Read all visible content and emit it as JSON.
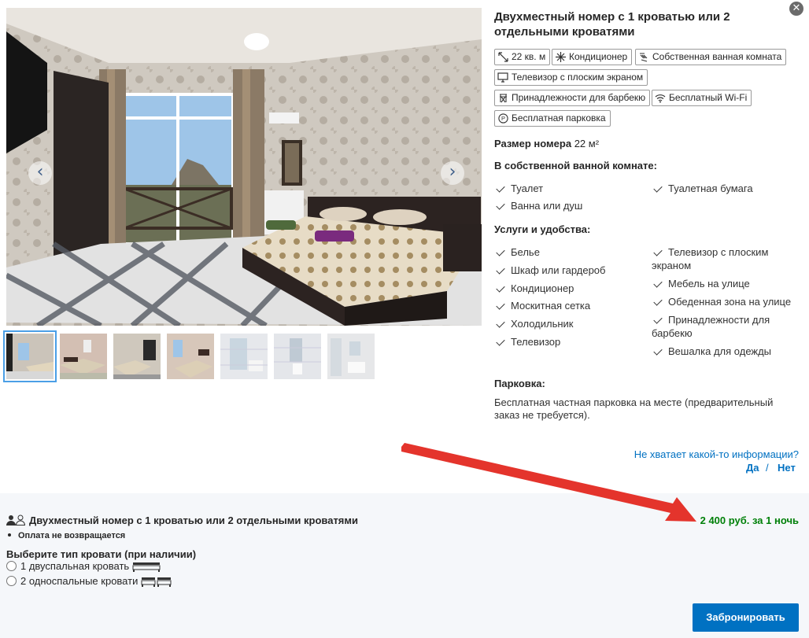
{
  "room": {
    "title": "Двухместный номер с 1 кроватью или 2 отдельными кроватями"
  },
  "facilities_chips": [
    {
      "label": "22 кв. м",
      "icon": "room-size-icon"
    },
    {
      "label": "Кондиционер",
      "icon": "snowflake-icon"
    },
    {
      "label": "Собственная ванная комната",
      "icon": "bath-icon"
    },
    {
      "label": "Телевизор с плоским экраном",
      "icon": "tv-icon"
    },
    {
      "label": "Принадлежности для барбекю",
      "icon": "grill-icon"
    },
    {
      "label": "Бесплатный Wi-Fi",
      "icon": "wifi-icon"
    },
    {
      "label": "Бесплатная парковка",
      "icon": "parking-icon"
    }
  ],
  "size": {
    "label": "Размер номера",
    "value": "22 м²"
  },
  "bathroom": {
    "heading": "В собственной ванной комнате:",
    "left": [
      "Туалет",
      "Ванна или душ"
    ],
    "right": [
      "Туалетная бумага"
    ]
  },
  "amenities": {
    "heading": "Услуги и удобства:",
    "left": [
      "Белье",
      "Шкаф или гардероб",
      "Кондиционер",
      "Москитная сетка",
      "Холодильник",
      "Телевизор"
    ],
    "right": [
      "Телевизор с плоским экраном",
      "Мебель на улице",
      "Обеденная зона на улице",
      "Принадлежности для барбекю",
      "Вешалка для одежды"
    ]
  },
  "parking": {
    "heading": "Парковка:",
    "text": "Бесплатная частная парковка на месте (предварительный заказ не требуется)."
  },
  "feedback": {
    "question": "Не хватает какой-то информации?",
    "yes": "Да",
    "slash": "/",
    "no": "Нет"
  },
  "gallery": {
    "prev": "‹",
    "next": "›",
    "thumb_count": 7,
    "active_thumb": 0
  },
  "offer": {
    "room_name": "Двухместный номер с 1 кроватью или 2 отдельными кроватями",
    "price": "2 400 руб. за 1 ночь",
    "policy": "Оплата не возвращается",
    "bed_prompt": "Выберите тип кровати (при наличии)",
    "bed_options": [
      "1 двуспальная кровать",
      "2 односпальные кровати"
    ],
    "book_label": "Забронировать"
  },
  "colors": {
    "accent": "#0071c2",
    "price": "#008009",
    "arrow": "#e4342c"
  }
}
